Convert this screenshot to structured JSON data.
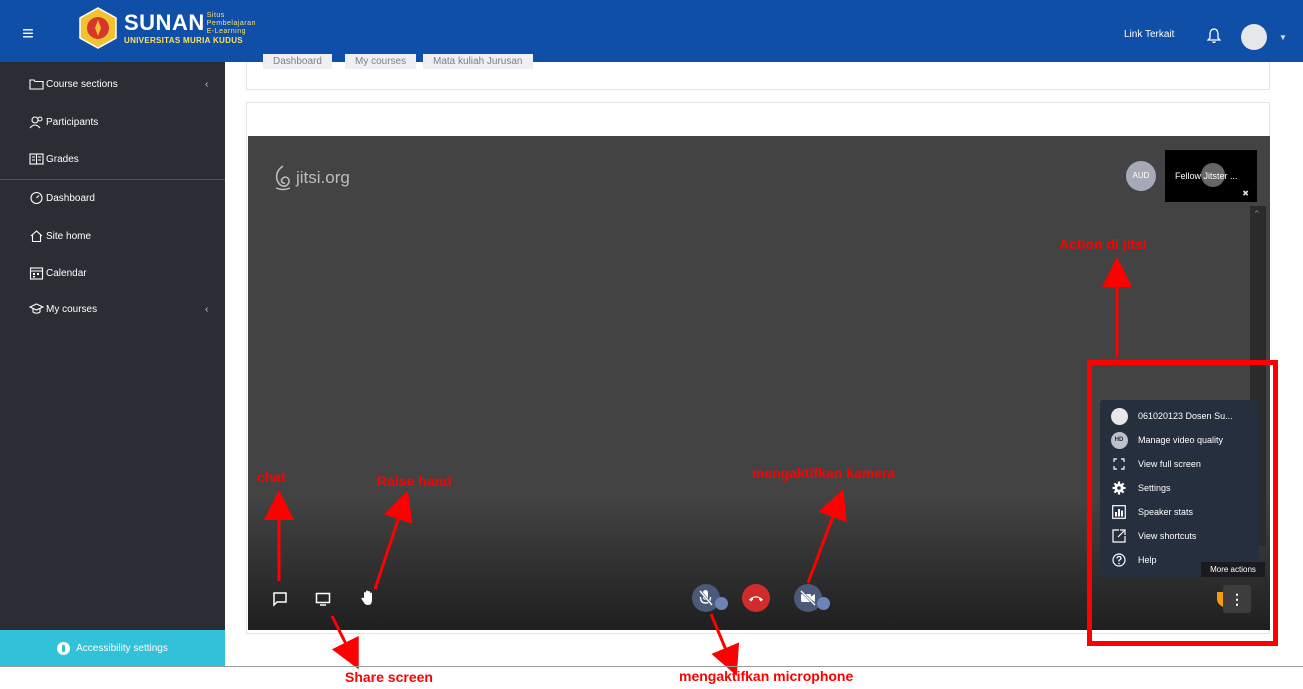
{
  "navbar": {
    "menu_icon": "hamburger-icon",
    "logo_brand": "SUNAN",
    "logo_tag": "Situs Pembelajaran E-Learning",
    "logo_university": "UNIVERSITAS MURIA KUDUS",
    "link_label": "Link Terkait",
    "notification_icon": "bell-icon",
    "brand_color": "#0f4fa8"
  },
  "sidebar": {
    "items": [
      {
        "label": "Course sections",
        "icon": "folder-icon",
        "has_caret": true
      },
      {
        "label": "Participants",
        "icon": "users-icon"
      },
      {
        "label": "Grades",
        "icon": "grades-icon"
      },
      {
        "label": "Dashboard",
        "icon": "gauge-icon"
      },
      {
        "label": "Site home",
        "icon": "home-icon"
      },
      {
        "label": "Calendar",
        "icon": "calendar-icon"
      },
      {
        "label": "My courses",
        "icon": "graduation-cap-icon",
        "has_caret": true
      }
    ],
    "caret": "‹",
    "accessibility_label": "Accessibility settings",
    "accessibility_color": "#31c1d9"
  },
  "breadcrumb": [
    "Dashboard",
    "My courses",
    "Mata kuliah Jurusan"
  ],
  "jitsi": {
    "logo_text": "jitsi.org",
    "remote_avatar": "AUD",
    "thumbnail_name": "Fellow Jitster ...",
    "menu": [
      {
        "label": "061020123 Dosen Su...",
        "icon": "avatar-icon"
      },
      {
        "label": "Manage video quality",
        "icon": "hd-icon",
        "icon_text": "HD"
      },
      {
        "label": "View full screen",
        "icon": "fullscreen-icon"
      },
      {
        "label": "Settings",
        "icon": "gear-icon"
      },
      {
        "label": "Speaker stats",
        "icon": "bar-chart-icon"
      },
      {
        "label": "View shortcuts",
        "icon": "external-link-icon"
      },
      {
        "label": "Help",
        "icon": "help-icon"
      }
    ],
    "tooltip": "More actions",
    "hangup_color": "#d12c2c"
  },
  "annotations": {
    "chat": "chat",
    "raise_hand": "Raise hand",
    "camera": "mengaktifkan kamera",
    "action": "Action di jitsi",
    "share_screen": "Share screen",
    "microphone": "mengaktifkan microphone",
    "color": "#ff0000"
  }
}
